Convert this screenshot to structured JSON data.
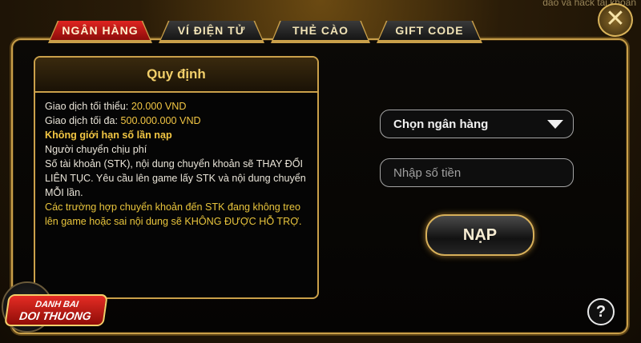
{
  "corner": {
    "text": "đảo và hack tài khoản"
  },
  "tabs": [
    {
      "label": "NGÂN HÀNG",
      "active": true
    },
    {
      "label": "VÍ ĐIỆN TỬ",
      "active": false
    },
    {
      "label": "THẺ CÀO",
      "active": false
    },
    {
      "label": "GIFT CODE",
      "active": false
    }
  ],
  "close": {
    "icon": "close-icon",
    "glyph": "✕"
  },
  "rules": {
    "title": "Quy định",
    "min_label": "Giao dịch tối thiểu: ",
    "min_value": "20.000 VND",
    "max_label": "Giao dịch tối đa: ",
    "max_value": "500.000.000 VND",
    "unlimited": "Không giới hạn số  lần nạp",
    "fee": "Người chuyển chịu phí",
    "account_note": "Số tài khoản (STK), nội dung chuyển khoản sẽ THAY ĐỔI LIÊN TỤC. Yêu cầu lên game lấy STK và nội dung chuyển MỖI lần.",
    "warning": "Các trường hợp chuyển khoản đến STK đang không treo lên game hoặc sai nội dung sẽ KHÔNG ĐƯỢC HỖ TRỢ."
  },
  "form": {
    "bank_select": "Chọn ngân hàng",
    "amount_placeholder": "Nhập số tiền",
    "submit": "NẠP"
  },
  "help": {
    "glyph": "?"
  },
  "logo": {
    "line1": "DANH BAI",
    "line2": "DOI THUONG"
  },
  "colors": {
    "accent_gold": "#caa04a",
    "active_tab": "#e02520",
    "highlight": "#f2c643"
  }
}
